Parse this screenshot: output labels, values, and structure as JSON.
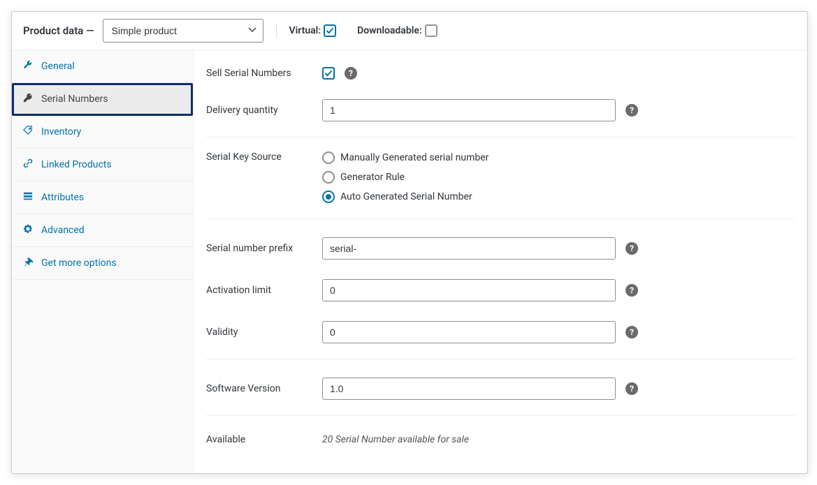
{
  "header": {
    "title": "Product data —",
    "product_type_selected": "Simple product",
    "virtual_label": "Virtual:",
    "virtual_checked": true,
    "downloadable_label": "Downloadable:",
    "downloadable_checked": false
  },
  "tabs": [
    {
      "key": "general",
      "label": "General",
      "icon": "wrench"
    },
    {
      "key": "serial-numbers",
      "label": "Serial Numbers",
      "icon": "key",
      "active": true
    },
    {
      "key": "inventory",
      "label": "Inventory",
      "icon": "tag"
    },
    {
      "key": "linked-products",
      "label": "Linked Products",
      "icon": "link"
    },
    {
      "key": "attributes",
      "label": "Attributes",
      "icon": "list"
    },
    {
      "key": "advanced",
      "label": "Advanced",
      "icon": "gear"
    },
    {
      "key": "get-more-options",
      "label": "Get more options",
      "icon": "pin"
    }
  ],
  "fields": {
    "sell_serial": {
      "label": "Sell Serial Numbers",
      "checked": true
    },
    "delivery_qty": {
      "label": "Delivery quantity",
      "value": "1"
    },
    "serial_source": {
      "label": "Serial Key Source",
      "options": [
        {
          "key": "manual",
          "label": "Manually Generated serial number",
          "checked": false
        },
        {
          "key": "rule",
          "label": "Generator Rule",
          "checked": false
        },
        {
          "key": "auto",
          "label": "Auto Generated Serial Number",
          "checked": true
        }
      ]
    },
    "prefix": {
      "label": "Serial number prefix",
      "value": "serial-"
    },
    "activation_limit": {
      "label": "Activation limit",
      "value": "0"
    },
    "validity": {
      "label": "Validity",
      "value": "0"
    },
    "software_version": {
      "label": "Software Version",
      "value": "1.0"
    },
    "available": {
      "label": "Available",
      "text": "20 Serial Number available for sale"
    }
  }
}
